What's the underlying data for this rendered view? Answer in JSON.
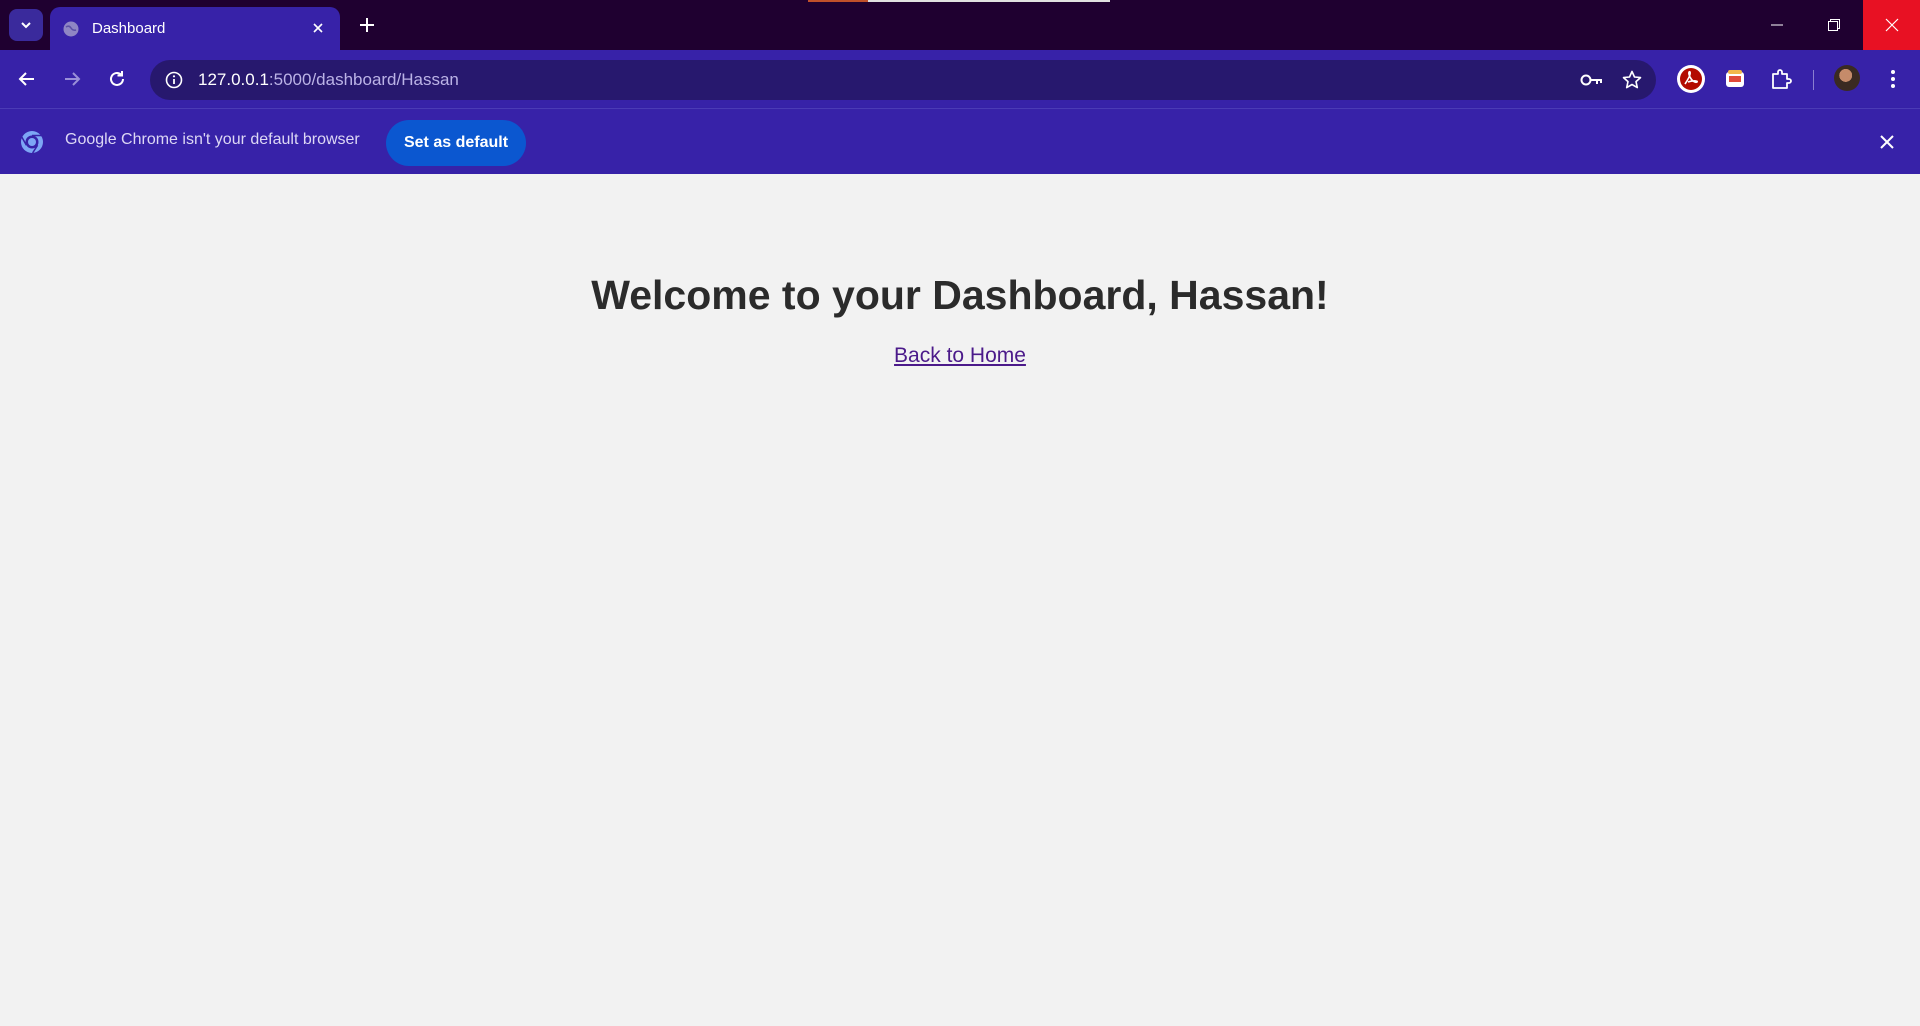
{
  "browser": {
    "tab": {
      "title": "Dashboard"
    },
    "address": {
      "host": "127.0.0.1",
      "path": ":5000/dashboard/Hassan"
    },
    "infobar": {
      "message": "Google Chrome isn't your default browser",
      "button_label": "Set as default"
    }
  },
  "page": {
    "heading": "Welcome to your Dashboard, Hassan!",
    "link_label": "Back to Home"
  },
  "colors": {
    "titlebar": "#1f0030",
    "toolbar": "#3722a8",
    "omnibox": "#27186e",
    "button": "#0b57d0",
    "link": "#4b1a8a",
    "close": "#e81123"
  },
  "icons": [
    "tab-search-icon",
    "globe-icon",
    "close-icon",
    "plus-icon",
    "minimize-icon",
    "restore-icon",
    "back-arrow-icon",
    "forward-arrow-icon",
    "reload-icon",
    "info-icon",
    "key-icon",
    "star-icon",
    "pdf-extension-icon",
    "extension-icon",
    "puzzle-icon",
    "kebab-menu-icon",
    "chrome-logo-icon"
  ]
}
